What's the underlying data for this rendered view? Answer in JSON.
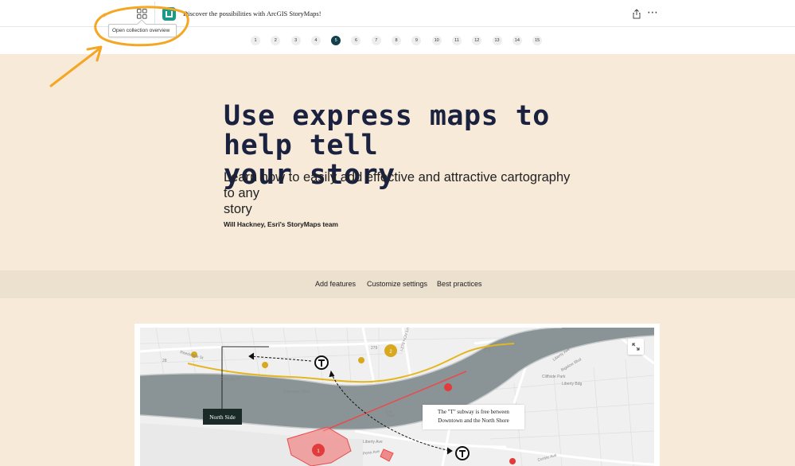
{
  "header": {
    "story_title": "Discover the possibilities with ArcGIS StoryMaps!",
    "collection_icon": "grid-icon",
    "tooltip": "Open collection overview",
    "share_icon": "share-icon",
    "more_icon": "more-icon"
  },
  "nav": {
    "pages": [
      "1",
      "2",
      "3",
      "4",
      "5",
      "6",
      "7",
      "8",
      "9",
      "10",
      "11",
      "12",
      "13",
      "14",
      "15"
    ],
    "active_page": "5"
  },
  "story": {
    "headline_line1": "Use express maps to help tell",
    "headline_line2": "your story",
    "subhead_line1": "Learn how to easily add effective and attractive cartography to any",
    "subhead_line2": "story",
    "byline": "Will Hackney, Esri's StoryMaps team"
  },
  "sections": {
    "add_features": "Add features",
    "customize_settings": "Customize settings",
    "best_practices": "Best practices"
  },
  "map": {
    "label_north_side": "North Side",
    "label_t_line1": "The \"T\" subway is free between",
    "label_t_line2": "Downtown and the North Shore",
    "pin_1": "1",
    "pin_2": "2",
    "expand_icon": "expand-icon",
    "streets": {
      "s1": "Reedsdale St",
      "s2": "Chateau St",
      "s3": "Clemente Park",
      "s4": "I-279 HOV Ln",
      "s5": "Liberty Ave",
      "s6": "Bigelow Blvd",
      "s7": "Penn Ave",
      "s8": "Centre Ave",
      "s9": "Liberty Ave",
      "s10": "Cliffside Park",
      "s11": "Liberty Bdg",
      "s12": "279",
      "s13": "279",
      "s14": "579",
      "s15": "28",
      "s16": "Park"
    },
    "colors": {
      "river": "#8a9497",
      "route": "#e4b620",
      "highlight": "#e94b4b",
      "pin_gold": "#d8a81e",
      "pin_red": "#e23b3b"
    }
  },
  "annotation_color": "#f5a623"
}
